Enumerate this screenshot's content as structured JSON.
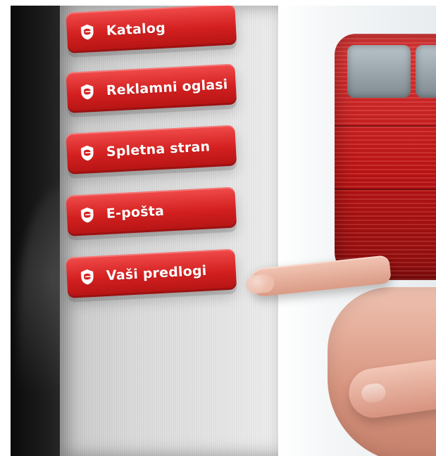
{
  "menu": {
    "items": [
      {
        "label": "Katalog",
        "icon": "brand-shield-icon"
      },
      {
        "label": "Reklamni oglasi",
        "icon": "brand-shield-icon"
      },
      {
        "label": "Spletna stran",
        "icon": "brand-shield-icon"
      },
      {
        "label": "E-pošta",
        "icon": "brand-shield-icon"
      },
      {
        "label": "Vaši predlogi",
        "icon": "brand-shield-icon"
      }
    ]
  },
  "colors": {
    "button_red": "#d31f1f",
    "button_text": "#ffffff",
    "panel_gray": "#dcdcdc"
  }
}
